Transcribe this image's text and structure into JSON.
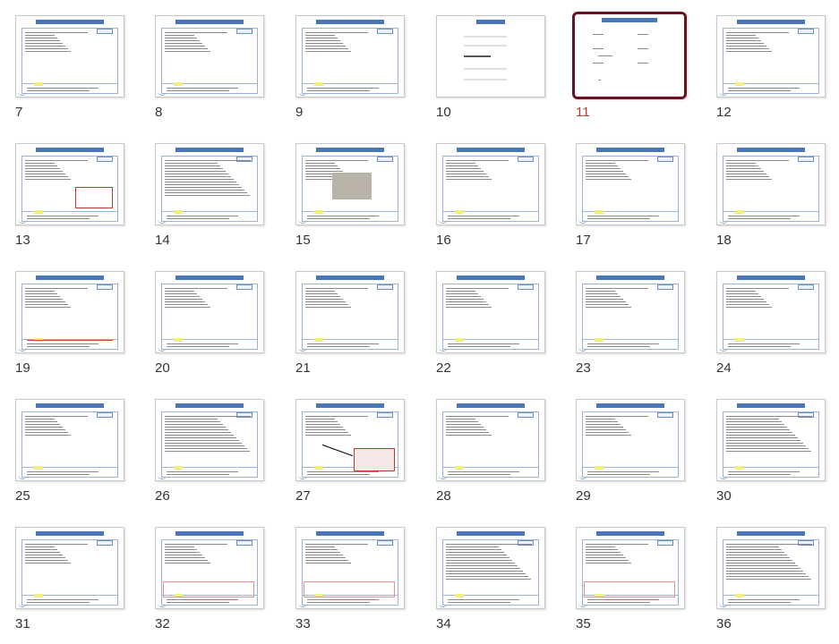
{
  "app": {
    "view": "slide-sorter"
  },
  "slides": [
    {
      "number": "7",
      "variant": "text"
    },
    {
      "number": "8",
      "variant": "text"
    },
    {
      "number": "9",
      "variant": "text"
    },
    {
      "number": "10",
      "variant": "toc"
    },
    {
      "number": "11",
      "variant": "agenda",
      "selected": true
    },
    {
      "number": "12",
      "variant": "text"
    },
    {
      "number": "13",
      "variant": "redbox"
    },
    {
      "number": "14",
      "variant": "dense"
    },
    {
      "number": "15",
      "variant": "image"
    },
    {
      "number": "16",
      "variant": "text"
    },
    {
      "number": "17",
      "variant": "text"
    },
    {
      "number": "18",
      "variant": "text"
    },
    {
      "number": "19",
      "variant": "redtext"
    },
    {
      "number": "20",
      "variant": "text"
    },
    {
      "number": "21",
      "variant": "text"
    },
    {
      "number": "22",
      "variant": "text"
    },
    {
      "number": "23",
      "variant": "text"
    },
    {
      "number": "24",
      "variant": "text"
    },
    {
      "number": "25",
      "variant": "text"
    },
    {
      "number": "26",
      "variant": "dense"
    },
    {
      "number": "27",
      "variant": "arrow"
    },
    {
      "number": "28",
      "variant": "text"
    },
    {
      "number": "29",
      "variant": "text"
    },
    {
      "number": "30",
      "variant": "dense"
    },
    {
      "number": "31",
      "variant": "text"
    },
    {
      "number": "32",
      "variant": "redpanel"
    },
    {
      "number": "33",
      "variant": "redpanel"
    },
    {
      "number": "34",
      "variant": "dense"
    },
    {
      "number": "35",
      "variant": "redpanel"
    },
    {
      "number": "36",
      "variant": "dense"
    }
  ],
  "colors": {
    "selected_border": "#6d1020",
    "selected_number": "#c0392b",
    "header_bar": "#4a76b8"
  }
}
